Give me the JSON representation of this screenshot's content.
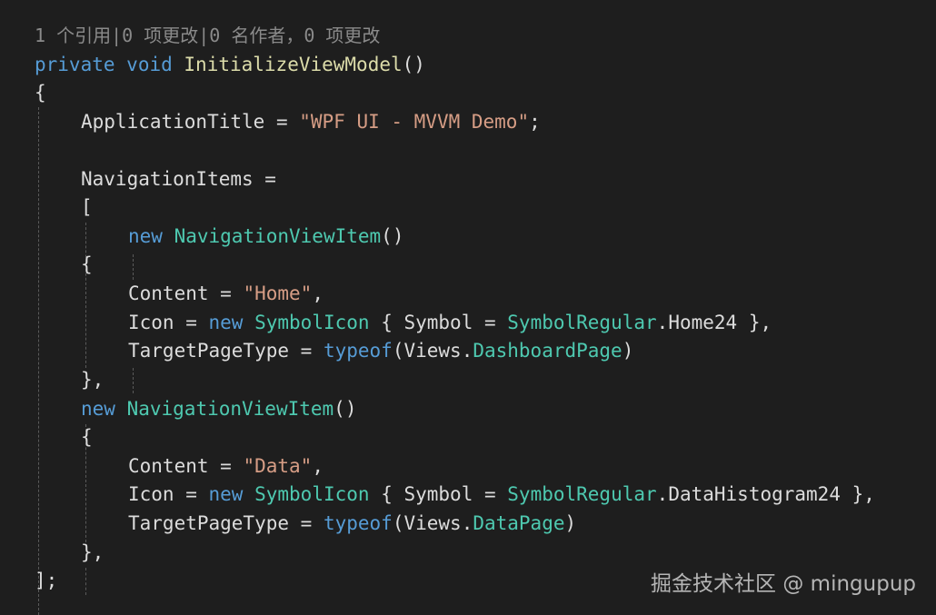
{
  "codelens": "1 个引用|0 项更改|0 名作者，0 项更改",
  "lines": {
    "l1": {
      "kw1": "private",
      "kw2": "void",
      "fn": "InitializeViewModel",
      "p": "()"
    },
    "l2": {
      "p": "{"
    },
    "l3": {
      "id": "ApplicationTitle",
      "op": " = ",
      "str": "\"WPF UI - MVVM Demo\"",
      "p": ";"
    },
    "l5": {
      "id": "NavigationItems",
      "op": " ="
    },
    "l6": {
      "p": "["
    },
    "l7": {
      "kw": "new",
      "ty": "NavigationViewItem",
      "p": "()"
    },
    "l8": {
      "p": "{"
    },
    "l9": {
      "id": "Content",
      "op": " = ",
      "str": "\"Home\"",
      "p": ","
    },
    "l10": {
      "id": "Icon",
      "op": " = ",
      "kw": "new",
      "ty": "SymbolIcon",
      "p1": " { ",
      "id2": "Symbol",
      "op2": " = ",
      "ty2": "SymbolRegular",
      "p2": ".",
      "id3": "Home24",
      "p3": " },"
    },
    "l11": {
      "id": "TargetPageType",
      "op": " = ",
      "kw": "typeof",
      "p1": "(",
      "id2": "Views",
      "p2": ".",
      "ty": "DashboardPage",
      "p3": ")"
    },
    "l12": {
      "p": "},"
    },
    "l13": {
      "kw": "new",
      "ty": "NavigationViewItem",
      "p": "()"
    },
    "l14": {
      "p": "{"
    },
    "l15": {
      "id": "Content",
      "op": " = ",
      "str": "\"Data\"",
      "p": ","
    },
    "l16": {
      "id": "Icon",
      "op": " = ",
      "kw": "new",
      "ty": "SymbolIcon",
      "p1": " { ",
      "id2": "Symbol",
      "op2": " = ",
      "ty2": "SymbolRegular",
      "p2": ".",
      "id3": "DataHistogram24",
      "p3": " },"
    },
    "l17": {
      "id": "TargetPageType",
      "op": " = ",
      "kw": "typeof",
      "p1": "(",
      "id2": "Views",
      "p2": ".",
      "ty": "DataPage",
      "p3": ")"
    },
    "l18": {
      "p": "},"
    },
    "l19": {
      "p": "];"
    }
  },
  "watermark": "掘金技术社区 @ mingupup",
  "colors": {
    "background": "#1e1e1e",
    "keyword": "#569cd6",
    "type": "#4ec9b0",
    "method": "#dcdcaa",
    "string": "#d69d85",
    "text": "#dcdcdc",
    "codelens": "#8a8a8a"
  }
}
